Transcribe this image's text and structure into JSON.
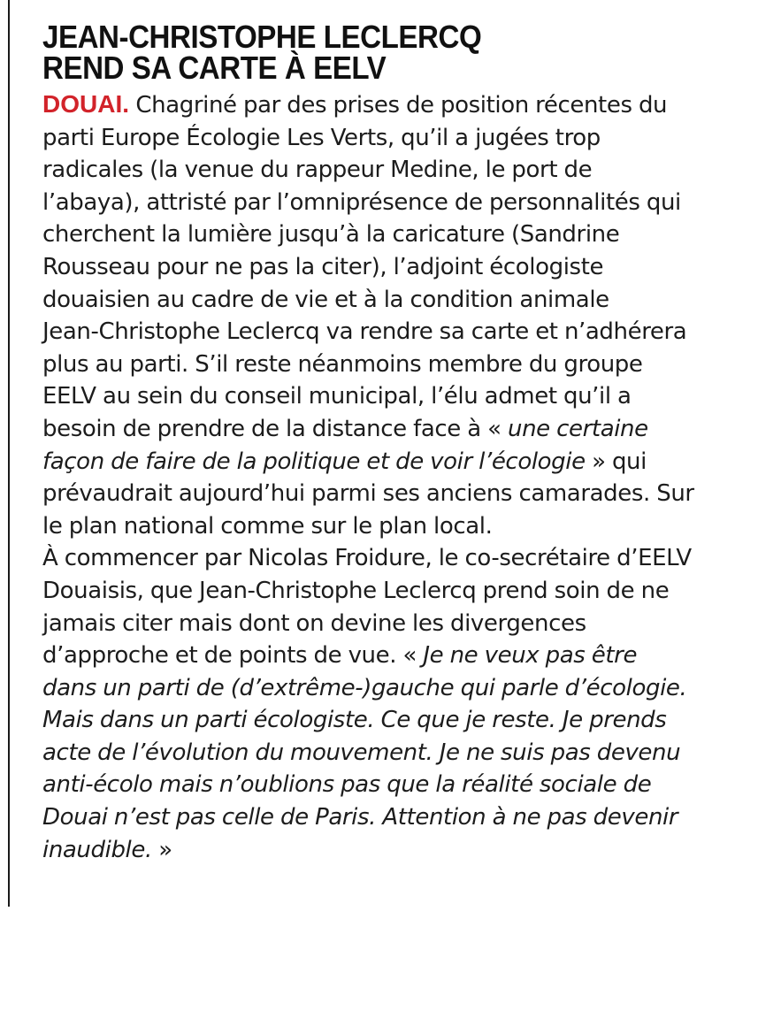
{
  "headline": {
    "line1": "JEAN-CHRISTOPHE LECLERCQ",
    "line2": "REND SA CARTE À EELV"
  },
  "article": {
    "dateline": "DOUAI.",
    "p1_l1": " Chagriné par des prises de position récentes du",
    "p1_l2": "parti Europe Écologie Les Verts, qu’il a jugées trop",
    "p1_l3": "radicales (la venue du rappeur Medine, le port de",
    "p1_l4": "l’abaya), attristé par l’omniprésence de personnalités qui",
    "p1_l5": "cherchent la lumière jusqu’à la caricature (Sandrine",
    "p1_l6": "Rousseau pour ne pas la citer), l’adjoint écologiste",
    "p1_l7": "douaisien au cadre de vie et à la condition animale",
    "p1_l8": "Jean-Christophe Leclercq va rendre sa carte et n’adhérera",
    "p1_l9": "plus au parti. S’il reste néanmoins membre du groupe",
    "p1_l10": "EELV au sein du conseil municipal, l’élu admet qu’il a",
    "p1_l11_a": "besoin de prendre de la distance face à « ",
    "p1_l11_quote": "une certaine",
    "p1_l12_quote": "façon de faire de la politique et de voir l’écologie",
    "p1_l12_b": " » qui",
    "p1_l13": "prévaudrait aujourd’hui parmi ses anciens camarades. Sur",
    "p1_l14": "le plan national comme sur le plan local.",
    "p2_l1": "À commencer par Nicolas Froidure, le co-secrétaire d’EELV",
    "p2_l2": "Douaisis, que Jean-Christophe Leclercq prend soin de ne",
    "p2_l3": "jamais citer mais dont on devine les divergences",
    "p2_l4_a": "d’approche et de points de vue. « ",
    "p2_l4_quote": "Je ne veux pas être",
    "p2_l5_quote": "dans un parti de (d’extrême-)gauche qui parle d’écologie.",
    "p2_l6_quote": "Mais dans un parti écologiste. Ce que je reste. Je prends",
    "p2_l7_quote": "acte de l’évolution du mouvement. Je ne suis pas devenu",
    "p2_l8_quote": "anti-écolo mais n’oublions pas que la réalité sociale de",
    "p2_l9_quote": "Douai n’est pas celle de Paris. Attention à ne pas devenir",
    "p2_l10_quote": "inaudible.",
    "p2_l10_b": " »"
  }
}
